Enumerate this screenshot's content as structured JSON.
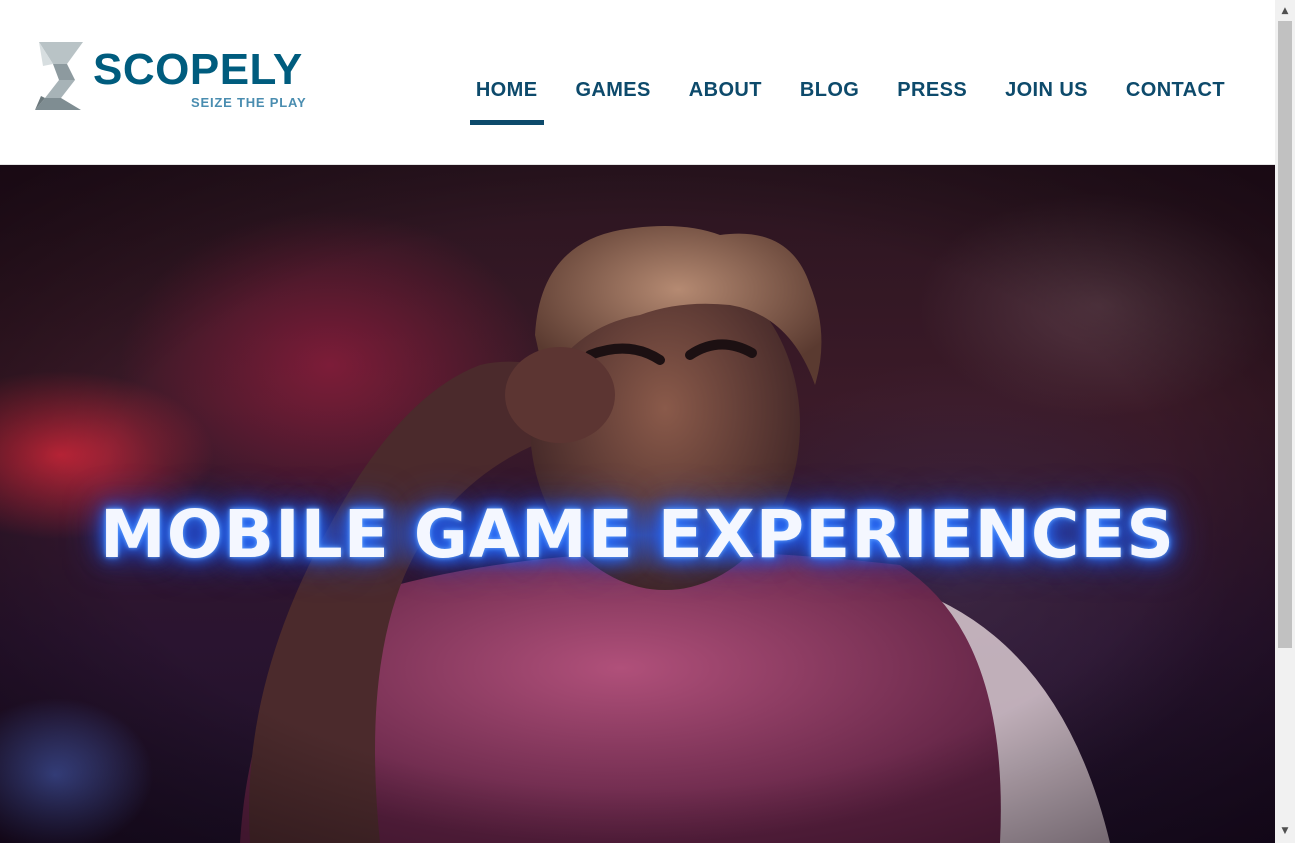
{
  "brand": {
    "name": "SCOPELY",
    "tagline": "SEIZE THE PLAY",
    "color": "#005c7e",
    "tagline_color": "#4a8db0"
  },
  "nav": {
    "items": [
      {
        "label": "HOME",
        "active": true
      },
      {
        "label": "GAMES",
        "active": false
      },
      {
        "label": "ABOUT",
        "active": false
      },
      {
        "label": "BLOG",
        "active": false
      },
      {
        "label": "PRESS",
        "active": false
      },
      {
        "label": "JOIN US",
        "active": false
      },
      {
        "label": "CONTACT",
        "active": false
      }
    ],
    "color": "#0d4a6b"
  },
  "hero": {
    "headline": "MOBILE GAME EXPERIENCES",
    "glow_color": "#2f7bff"
  },
  "scrollbar": {
    "up_icon": "triangle-up-icon",
    "down_icon": "triangle-down-icon"
  }
}
